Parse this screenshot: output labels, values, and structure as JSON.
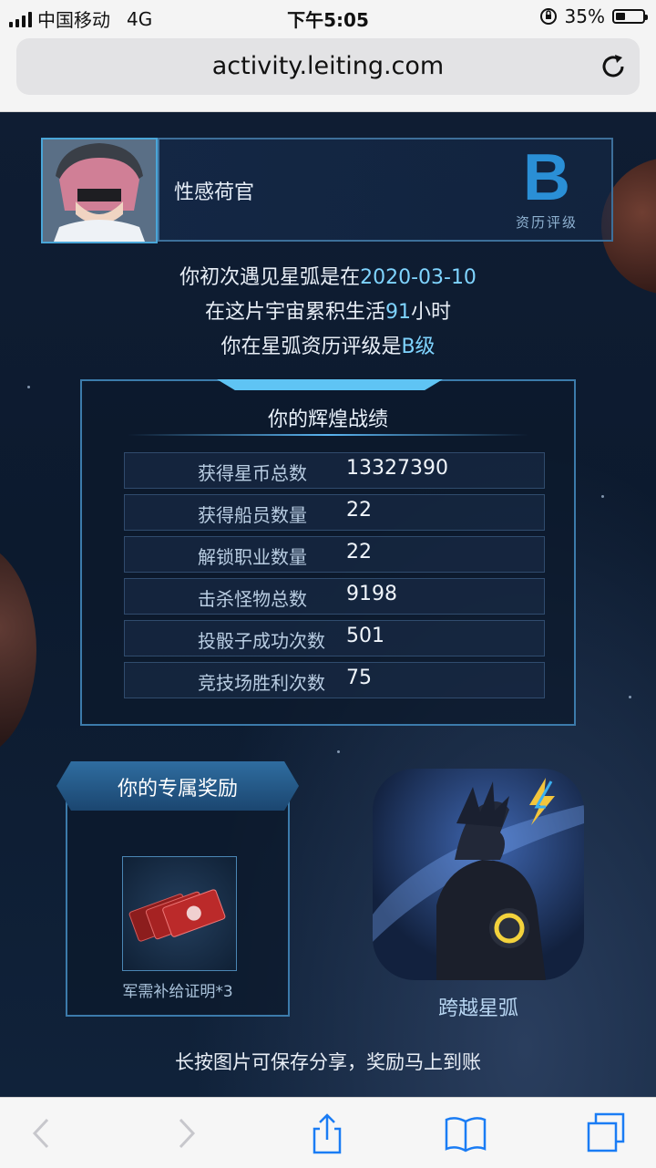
{
  "status_bar": {
    "carrier": "中国移动",
    "network": "4G",
    "time": "下午5:05",
    "battery_percent": "35%",
    "battery_level": 0.35
  },
  "browser": {
    "url": "activity.leiting.com"
  },
  "profile": {
    "player_name": "性感荷官",
    "grade_letter": "B",
    "grade_label": "资历评级"
  },
  "summary": {
    "line1_prefix": "你初次遇见星弧是在",
    "first_date": "2020-03-10",
    "line2_prefix": "在这片宇宙累积生活",
    "hours": "91",
    "line2_suffix": "小时",
    "line3_prefix": "你在星弧资历评级是",
    "grade": "B级"
  },
  "record": {
    "title": "你的辉煌战绩",
    "rows": [
      {
        "label": "获得星币总数",
        "value": "13327390"
      },
      {
        "label": "获得船员数量",
        "value": "22"
      },
      {
        "label": "解锁职业数量",
        "value": "22"
      },
      {
        "label": "击杀怪物总数",
        "value": "9198"
      },
      {
        "label": "投骰子成功次数",
        "value": "501"
      },
      {
        "label": "竞技场胜利次数",
        "value": "75"
      }
    ]
  },
  "reward": {
    "title": "你的专属奖励",
    "item_label": "军需补给证明*3"
  },
  "app": {
    "name": "跨越星弧"
  },
  "hint": "长按图片可保存分享，奖励马上到账",
  "toolbar": {
    "back_icon": "chevron-left-icon",
    "forward_icon": "chevron-right-icon",
    "share_icon": "share-icon",
    "bookmarks_icon": "book-icon",
    "tabs_icon": "tabs-icon"
  }
}
